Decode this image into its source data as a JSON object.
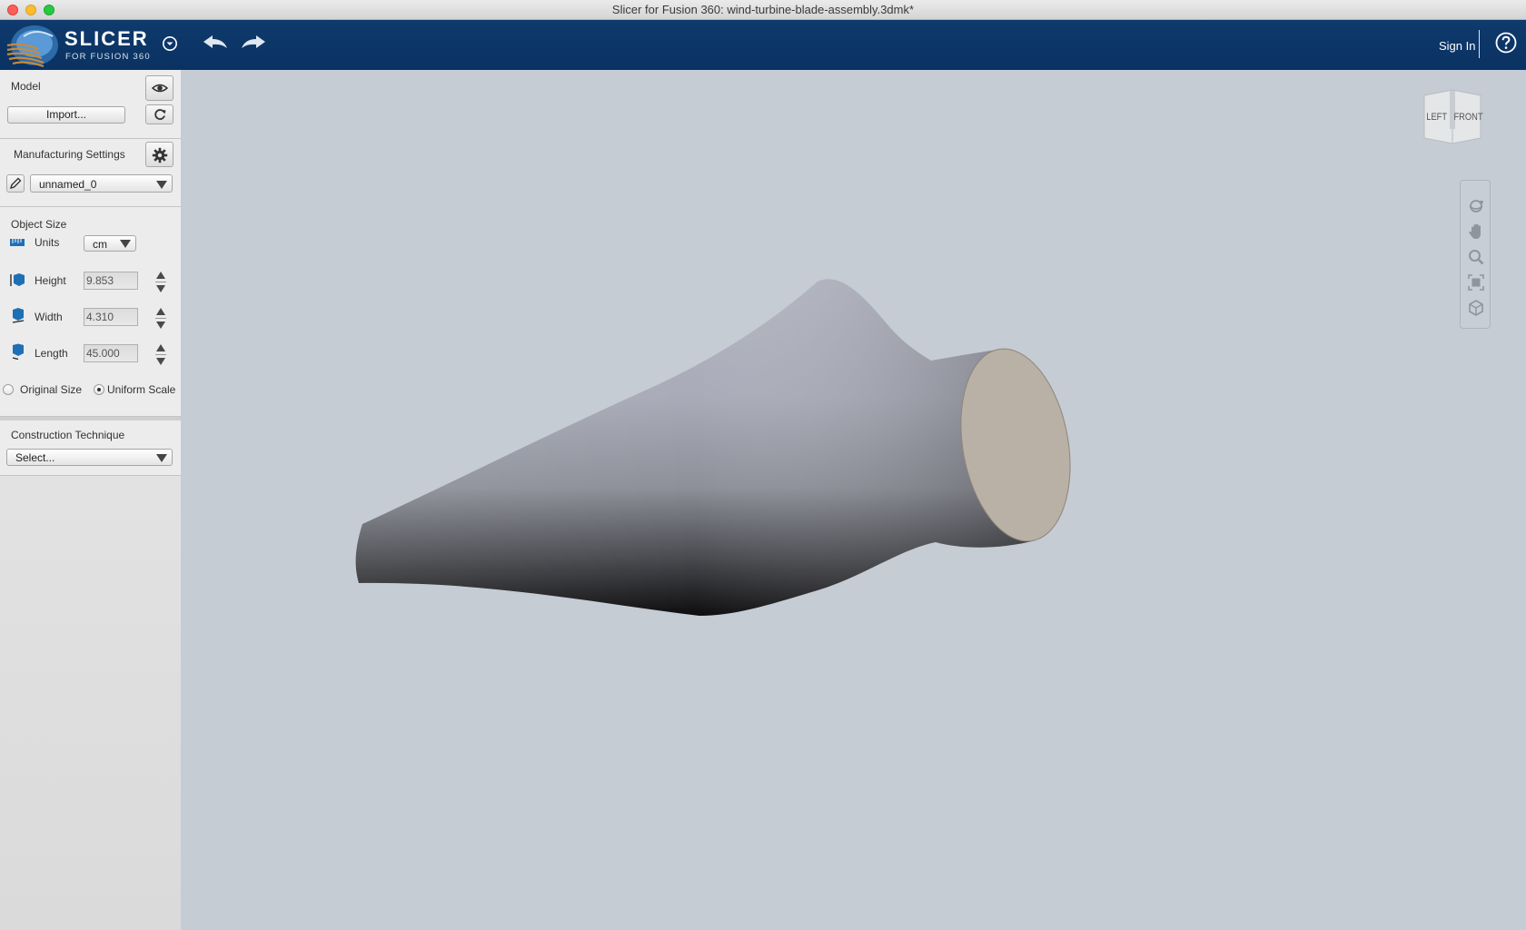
{
  "window": {
    "title": "Slicer for Fusion 360: wind-turbine-blade-assembly.3dmk*"
  },
  "appbar": {
    "logo_title": "SLICER",
    "logo_subtitle": "FOR FUSION 360",
    "sign_in_label": "Sign In",
    "icons": [
      "app-menu-icon",
      "undo-icon",
      "redo-icon",
      "help-icon"
    ]
  },
  "model": {
    "heading": "Model",
    "import_label": "Import..."
  },
  "manufacturing": {
    "heading": "Manufacturing Settings",
    "profile_value": "unnamed_0"
  },
  "object_size": {
    "heading": "Object Size",
    "units_label": "Units",
    "units_value": "cm",
    "height_label": "Height",
    "height_value": "9.853",
    "width_label": "Width",
    "width_value": "4.310",
    "length_label": "Length",
    "length_value": "45.000",
    "original_size_label": "Original Size",
    "uniform_scale_label": "Uniform Scale",
    "selected_option": "Uniform Scale"
  },
  "construction": {
    "heading": "Construction Technique",
    "select_value": "Select..."
  },
  "viewcube": {
    "left_label": "LEFT",
    "front_label": "FRONT"
  },
  "navigation_tools": [
    "orbit-icon",
    "pan-icon",
    "zoom-icon",
    "fit-icon",
    "home-view-icon"
  ],
  "colors": {
    "header_bg": "#0a3263",
    "viewport_bg": "#c5ccd4",
    "sidebar_bg": "#ececec",
    "model_end_cap": "#b9b1a6"
  }
}
